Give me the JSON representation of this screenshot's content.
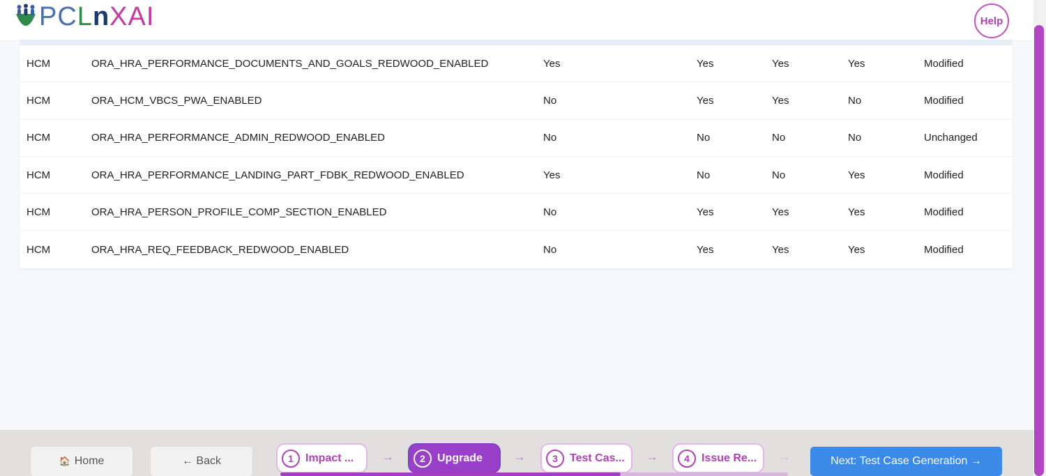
{
  "header": {
    "logo_text": "PCLnXAI",
    "help_label": "Help"
  },
  "table": {
    "rows": [
      [
        "HCM",
        "ORA_HRA_PERFORMANCE_DOCUMENTS_AND_GOALS_REDWOOD_ENABLED",
        "Yes",
        "Yes",
        "Yes",
        "Yes",
        "Modified"
      ],
      [
        "HCM",
        "ORA_HCM_VBCS_PWA_ENABLED",
        "No",
        "Yes",
        "Yes",
        "No",
        "Modified"
      ],
      [
        "HCM",
        "ORA_HRA_PERFORMANCE_ADMIN_REDWOOD_ENABLED",
        "No",
        "No",
        "No",
        "No",
        "Unchanged"
      ],
      [
        "HCM",
        "ORA_HRA_PERFORMANCE_LANDING_PART_FDBK_REDWOOD_ENABLED",
        "Yes",
        "No",
        "No",
        "Yes",
        "Modified"
      ],
      [
        "HCM",
        "ORA_HRA_PERSON_PROFILE_COMP_SECTION_ENABLED",
        "No",
        "Yes",
        "Yes",
        "Yes",
        "Modified"
      ],
      [
        "HCM",
        "ORA_HRA_REQ_FEEDBACK_REDWOOD_ENABLED",
        "No",
        "Yes",
        "Yes",
        "Yes",
        "Modified"
      ]
    ]
  },
  "footer": {
    "home_icon": "🏠",
    "home_label": "Home",
    "back_label": "← Back",
    "steps": [
      {
        "num": "1",
        "label": "Impact ..."
      },
      {
        "num": "2",
        "label": "Upgrade"
      },
      {
        "num": "3",
        "label": "Test Cas..."
      },
      {
        "num": "4",
        "label": "Issue Re..."
      }
    ],
    "arrow": "→",
    "progress_fraction": 0.67,
    "next_label": "Next: Test Case Generation →"
  },
  "colors": {
    "accent": "#b040b8",
    "next_button": "#3b8ae8",
    "active_step": "#9a3fc8"
  }
}
